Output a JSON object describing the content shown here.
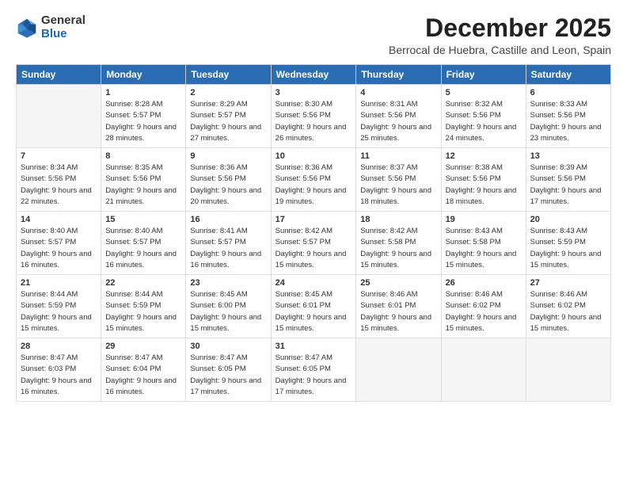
{
  "logo": {
    "general": "General",
    "blue": "Blue"
  },
  "title": "December 2025",
  "subtitle": "Berrocal de Huebra, Castille and Leon, Spain",
  "headers": [
    "Sunday",
    "Monday",
    "Tuesday",
    "Wednesday",
    "Thursday",
    "Friday",
    "Saturday"
  ],
  "weeks": [
    [
      {
        "num": "",
        "sunrise": "",
        "sunset": "",
        "daylight": ""
      },
      {
        "num": "1",
        "sunrise": "Sunrise: 8:28 AM",
        "sunset": "Sunset: 5:57 PM",
        "daylight": "Daylight: 9 hours and 28 minutes."
      },
      {
        "num": "2",
        "sunrise": "Sunrise: 8:29 AM",
        "sunset": "Sunset: 5:57 PM",
        "daylight": "Daylight: 9 hours and 27 minutes."
      },
      {
        "num": "3",
        "sunrise": "Sunrise: 8:30 AM",
        "sunset": "Sunset: 5:56 PM",
        "daylight": "Daylight: 9 hours and 26 minutes."
      },
      {
        "num": "4",
        "sunrise": "Sunrise: 8:31 AM",
        "sunset": "Sunset: 5:56 PM",
        "daylight": "Daylight: 9 hours and 25 minutes."
      },
      {
        "num": "5",
        "sunrise": "Sunrise: 8:32 AM",
        "sunset": "Sunset: 5:56 PM",
        "daylight": "Daylight: 9 hours and 24 minutes."
      },
      {
        "num": "6",
        "sunrise": "Sunrise: 8:33 AM",
        "sunset": "Sunset: 5:56 PM",
        "daylight": "Daylight: 9 hours and 23 minutes."
      }
    ],
    [
      {
        "num": "7",
        "sunrise": "Sunrise: 8:34 AM",
        "sunset": "Sunset: 5:56 PM",
        "daylight": "Daylight: 9 hours and 22 minutes."
      },
      {
        "num": "8",
        "sunrise": "Sunrise: 8:35 AM",
        "sunset": "Sunset: 5:56 PM",
        "daylight": "Daylight: 9 hours and 21 minutes."
      },
      {
        "num": "9",
        "sunrise": "Sunrise: 8:36 AM",
        "sunset": "Sunset: 5:56 PM",
        "daylight": "Daylight: 9 hours and 20 minutes."
      },
      {
        "num": "10",
        "sunrise": "Sunrise: 8:36 AM",
        "sunset": "Sunset: 5:56 PM",
        "daylight": "Daylight: 9 hours and 19 minutes."
      },
      {
        "num": "11",
        "sunrise": "Sunrise: 8:37 AM",
        "sunset": "Sunset: 5:56 PM",
        "daylight": "Daylight: 9 hours and 18 minutes."
      },
      {
        "num": "12",
        "sunrise": "Sunrise: 8:38 AM",
        "sunset": "Sunset: 5:56 PM",
        "daylight": "Daylight: 9 hours and 18 minutes."
      },
      {
        "num": "13",
        "sunrise": "Sunrise: 8:39 AM",
        "sunset": "Sunset: 5:56 PM",
        "daylight": "Daylight: 9 hours and 17 minutes."
      }
    ],
    [
      {
        "num": "14",
        "sunrise": "Sunrise: 8:40 AM",
        "sunset": "Sunset: 5:57 PM",
        "daylight": "Daylight: 9 hours and 16 minutes."
      },
      {
        "num": "15",
        "sunrise": "Sunrise: 8:40 AM",
        "sunset": "Sunset: 5:57 PM",
        "daylight": "Daylight: 9 hours and 16 minutes."
      },
      {
        "num": "16",
        "sunrise": "Sunrise: 8:41 AM",
        "sunset": "Sunset: 5:57 PM",
        "daylight": "Daylight: 9 hours and 16 minutes."
      },
      {
        "num": "17",
        "sunrise": "Sunrise: 8:42 AM",
        "sunset": "Sunset: 5:57 PM",
        "daylight": "Daylight: 9 hours and 15 minutes."
      },
      {
        "num": "18",
        "sunrise": "Sunrise: 8:42 AM",
        "sunset": "Sunset: 5:58 PM",
        "daylight": "Daylight: 9 hours and 15 minutes."
      },
      {
        "num": "19",
        "sunrise": "Sunrise: 8:43 AM",
        "sunset": "Sunset: 5:58 PM",
        "daylight": "Daylight: 9 hours and 15 minutes."
      },
      {
        "num": "20",
        "sunrise": "Sunrise: 8:43 AM",
        "sunset": "Sunset: 5:59 PM",
        "daylight": "Daylight: 9 hours and 15 minutes."
      }
    ],
    [
      {
        "num": "21",
        "sunrise": "Sunrise: 8:44 AM",
        "sunset": "Sunset: 5:59 PM",
        "daylight": "Daylight: 9 hours and 15 minutes."
      },
      {
        "num": "22",
        "sunrise": "Sunrise: 8:44 AM",
        "sunset": "Sunset: 5:59 PM",
        "daylight": "Daylight: 9 hours and 15 minutes."
      },
      {
        "num": "23",
        "sunrise": "Sunrise: 8:45 AM",
        "sunset": "Sunset: 6:00 PM",
        "daylight": "Daylight: 9 hours and 15 minutes."
      },
      {
        "num": "24",
        "sunrise": "Sunrise: 8:45 AM",
        "sunset": "Sunset: 6:01 PM",
        "daylight": "Daylight: 9 hours and 15 minutes."
      },
      {
        "num": "25",
        "sunrise": "Sunrise: 8:46 AM",
        "sunset": "Sunset: 6:01 PM",
        "daylight": "Daylight: 9 hours and 15 minutes."
      },
      {
        "num": "26",
        "sunrise": "Sunrise: 8:46 AM",
        "sunset": "Sunset: 6:02 PM",
        "daylight": "Daylight: 9 hours and 15 minutes."
      },
      {
        "num": "27",
        "sunrise": "Sunrise: 8:46 AM",
        "sunset": "Sunset: 6:02 PM",
        "daylight": "Daylight: 9 hours and 15 minutes."
      }
    ],
    [
      {
        "num": "28",
        "sunrise": "Sunrise: 8:47 AM",
        "sunset": "Sunset: 6:03 PM",
        "daylight": "Daylight: 9 hours and 16 minutes."
      },
      {
        "num": "29",
        "sunrise": "Sunrise: 8:47 AM",
        "sunset": "Sunset: 6:04 PM",
        "daylight": "Daylight: 9 hours and 16 minutes."
      },
      {
        "num": "30",
        "sunrise": "Sunrise: 8:47 AM",
        "sunset": "Sunset: 6:05 PM",
        "daylight": "Daylight: 9 hours and 17 minutes."
      },
      {
        "num": "31",
        "sunrise": "Sunrise: 8:47 AM",
        "sunset": "Sunset: 6:05 PM",
        "daylight": "Daylight: 9 hours and 17 minutes."
      },
      {
        "num": "",
        "sunrise": "",
        "sunset": "",
        "daylight": ""
      },
      {
        "num": "",
        "sunrise": "",
        "sunset": "",
        "daylight": ""
      },
      {
        "num": "",
        "sunrise": "",
        "sunset": "",
        "daylight": ""
      }
    ]
  ]
}
